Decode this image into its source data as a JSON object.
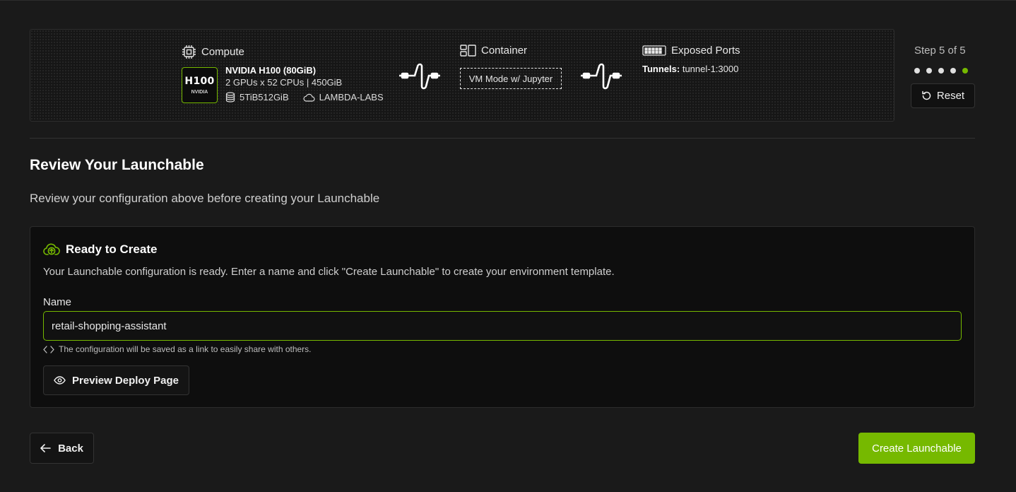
{
  "summary": {
    "compute": {
      "heading": "Compute",
      "icon": "cpu-chip-icon",
      "gpu_tile": {
        "chip": "H100",
        "brand": "NVIDIA"
      },
      "gpu_name": "NVIDIA H100 (80GiB)",
      "gpu_spec": "2 GPUs x 52 CPUs | 450GiB",
      "storage": "5TiB512GiB",
      "provider": "LAMBDA-LABS"
    },
    "container": {
      "heading": "Container",
      "icon": "container-layout-icon",
      "mode": "VM Mode w/ Jupyter"
    },
    "ports": {
      "heading": "Exposed Ports",
      "icon": "ports-icon",
      "tunnels_label": "Tunnels:",
      "tunnels_value": "tunnel-1:3000"
    }
  },
  "stepper": {
    "label": "Step 5 of 5",
    "total": 5,
    "current": 5,
    "reset_label": "Reset"
  },
  "page": {
    "title": "Review Your Launchable",
    "subtitle": "Review your configuration above before creating your Launchable"
  },
  "card": {
    "title": "Ready to Create",
    "description": "Your Launchable configuration is ready. Enter a name and click \"Create Launchable\" to create your environment template.",
    "name_label": "Name",
    "name_value": "retail-shopping-assistant",
    "helper_text": "The configuration will be saved as a link to easily share with others.",
    "preview_label": "Preview Deploy Page"
  },
  "footer": {
    "back_label": "Back",
    "create_label": "Create Launchable"
  },
  "colors": {
    "accent": "#76b900",
    "background": "#1a1a1a",
    "card": "#0e0e0e"
  }
}
